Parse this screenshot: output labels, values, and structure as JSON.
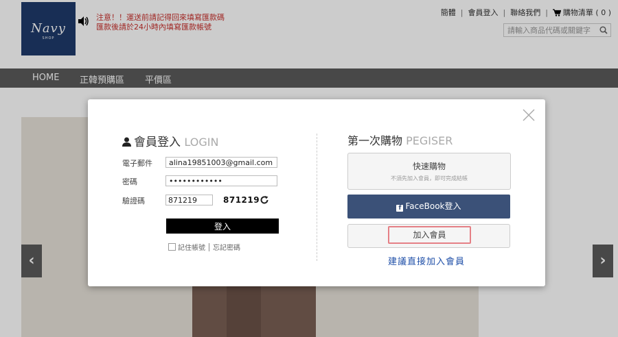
{
  "header": {
    "logo": {
      "main": "Navy",
      "sub": "SHOP"
    },
    "notice": "注意！！運送前請記得回來填寫匯款碼",
    "notice_line2": "匯款後請於24小時內填寫匯款帳號",
    "top_links": [
      "簡體",
      "會員登入",
      "聯絡我們"
    ],
    "cart_label": "購物清單 ( 0 )",
    "search_placeholder": "請輸入商品代碼或關鍵字"
  },
  "mainnav": {
    "items": [
      "HOME",
      "正韓預購區",
      "平價區"
    ]
  },
  "login": {
    "title": "會員登入",
    "title_en": "LOGIN",
    "email_label": "電子郵件",
    "email_value": "alina19851003@gmail.com",
    "password_label": "密碼",
    "password_value": "••••••••••••",
    "captcha_label": "驗證碼",
    "captcha_value": "871219",
    "captcha_code": "871219",
    "submit": "登入",
    "remember": "記住帳號",
    "forgot": "忘記密碼"
  },
  "first_time": {
    "title": "第一次購物",
    "title_en": "PEGISER",
    "quick_label": "快速購物",
    "quick_sub": "不須先加入會員，即可完成結帳",
    "facebook_label": "FaceBook登入",
    "join_label": "加入會員",
    "suggest": "建議直接加入會員"
  },
  "colors": {
    "overlay": "rgba(0,0,0,0.2)",
    "facebook": "#3b5178",
    "highlight": "#e57f85",
    "link": "#1f4fa8"
  }
}
